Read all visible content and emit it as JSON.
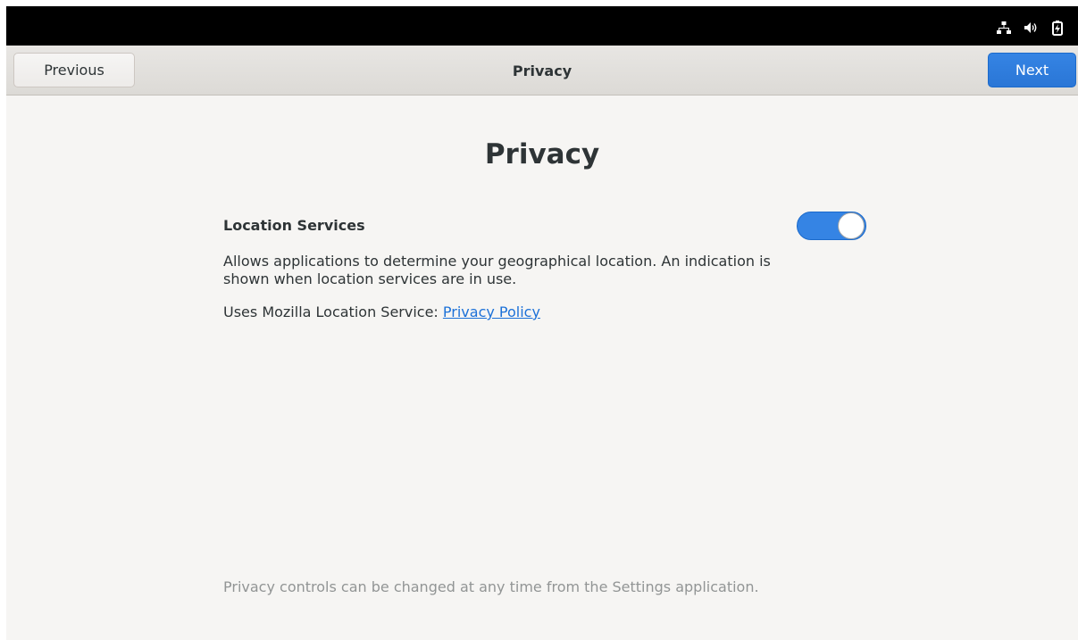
{
  "header": {
    "previous_label": "Previous",
    "title": "Privacy",
    "next_label": "Next"
  },
  "tray": {
    "icons": [
      "network-icon",
      "volume-icon",
      "battery-icon"
    ]
  },
  "page": {
    "title": "Privacy",
    "location": {
      "label": "Location Services",
      "enabled": true,
      "description": "Allows applications to determine your geographical location. An indication is shown when location services are in use.",
      "policy_prefix": "Uses Mozilla Location Service: ",
      "policy_link": "Privacy Policy"
    },
    "footer_note": "Privacy controls can be changed at any time from the Settings application."
  },
  "colors": {
    "accent": "#3584e4",
    "link": "#1c71d8",
    "text": "#2e3436",
    "footer_text": "#929595"
  }
}
